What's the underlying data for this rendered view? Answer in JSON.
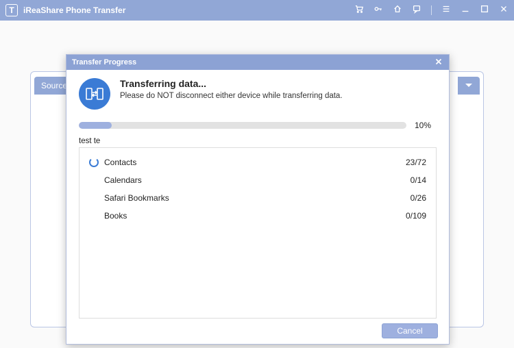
{
  "titlebar": {
    "app_name": "iReaShare Phone Transfer",
    "logo_letter": "T"
  },
  "background": {
    "source_label": "Source:"
  },
  "dialog": {
    "title": "Transfer Progress",
    "heading": "Transferring data...",
    "subheading": "Please do NOT disconnect either device while transferring data.",
    "progress_percent": 10,
    "progress_text": "10%",
    "subtitle": "test te",
    "items": [
      {
        "label": "Contacts",
        "done": 23,
        "total": 72,
        "active": true
      },
      {
        "label": "Calendars",
        "done": 0,
        "total": 14,
        "active": false
      },
      {
        "label": "Safari Bookmarks",
        "done": 0,
        "total": 26,
        "active": false
      },
      {
        "label": "Books",
        "done": 0,
        "total": 109,
        "active": false
      }
    ],
    "cancel_label": "Cancel"
  }
}
